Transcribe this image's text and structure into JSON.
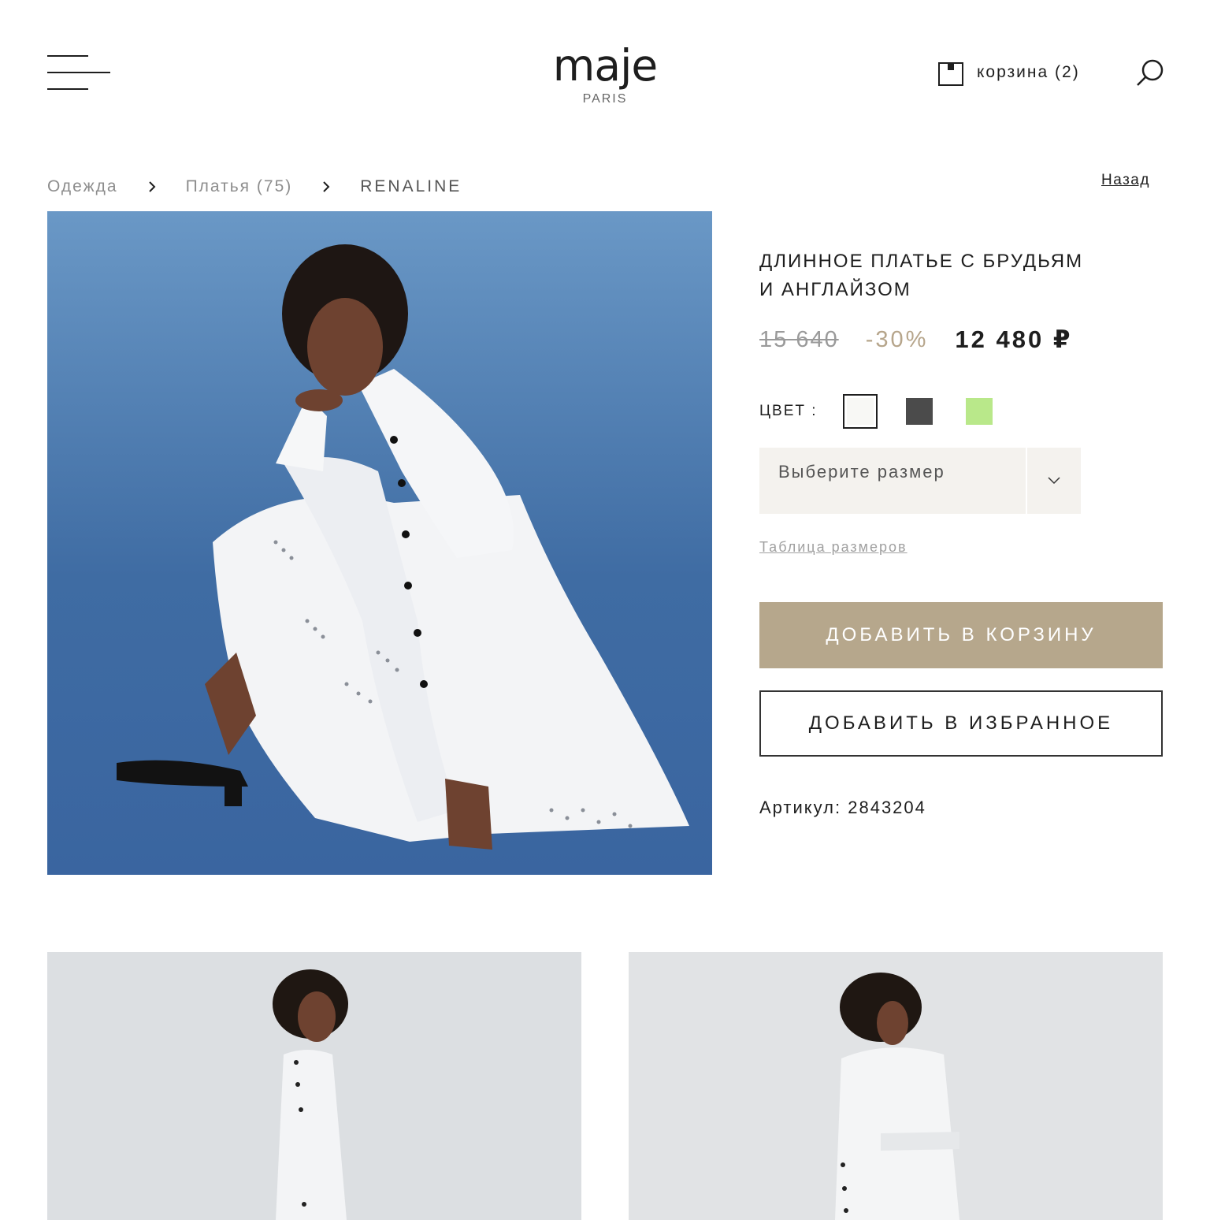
{
  "header": {
    "logo": "maje",
    "logo_sub": "PARIS",
    "cart_label": "корзина (2)"
  },
  "breadcrumb": {
    "items": [
      "Одежда",
      "Платья (75)"
    ],
    "current": "RENALINE",
    "back_label": "Назад"
  },
  "product": {
    "title_line1": "ДЛИННОЕ ПЛАТЬЕ С БРУДЬЯМ",
    "title_line2": "И АНГЛАЙЗОМ",
    "price_old": "15 640",
    "discount": "-30%",
    "price_new": "12 480 ₽",
    "color_label": "ЦВЕТ :",
    "colors": [
      {
        "hex": "#f8f8f5",
        "selected": true
      },
      {
        "hex": "#4b4b4b",
        "selected": false
      },
      {
        "hex": "#b9e88a",
        "selected": false
      }
    ],
    "size_placeholder": "Выберите размер",
    "size_table_link": "Таблица размеров",
    "add_to_cart": "ДОБАВИТЬ В КОРЗИНУ",
    "add_to_favorites": "ДОБАВИТЬ В ИЗБРАННОЕ",
    "sku": "Артикул: 2843204"
  },
  "colors": {
    "accent": "#b6a78c",
    "discount": "#b6a58b",
    "hero_background": "#3f6ca3",
    "gallery_background": "#dfe1e3"
  },
  "icons": [
    "menu-icon",
    "cart-icon",
    "search-icon",
    "chevron-right-icon",
    "chevron-down-icon"
  ]
}
